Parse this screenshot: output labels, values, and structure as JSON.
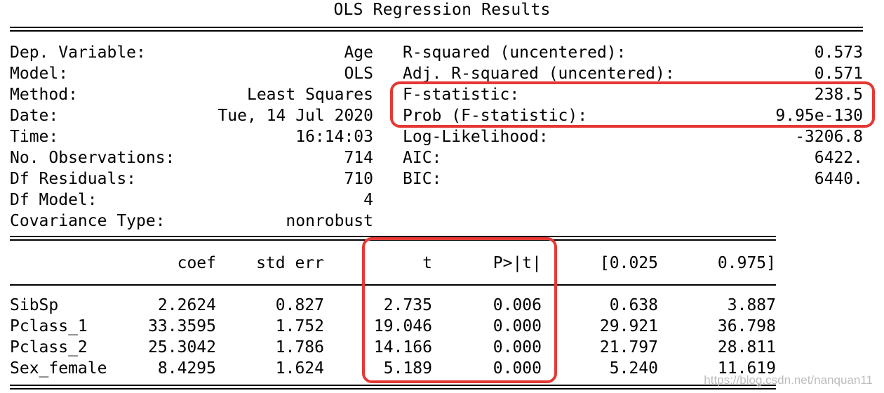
{
  "title": "OLS Regression Results",
  "summary": {
    "left": [
      {
        "label": "Dep. Variable:",
        "value": "Age"
      },
      {
        "label": "Model:",
        "value": "OLS"
      },
      {
        "label": "Method:",
        "value": "Least Squares"
      },
      {
        "label": "Date:",
        "value": "Tue, 14 Jul 2020"
      },
      {
        "label": "Time:",
        "value": "16:14:03"
      },
      {
        "label": "No. Observations:",
        "value": "714"
      },
      {
        "label": "Df Residuals:",
        "value": "710"
      },
      {
        "label": "Df Model:",
        "value": "4"
      },
      {
        "label": "Covariance Type:",
        "value": "nonrobust"
      }
    ],
    "right": [
      {
        "label": "R-squared (uncentered):",
        "value": "0.573"
      },
      {
        "label": "Adj. R-squared (uncentered):",
        "value": "0.571"
      },
      {
        "label": "F-statistic:",
        "value": "238.5"
      },
      {
        "label": "Prob (F-statistic):",
        "value": "9.95e-130"
      },
      {
        "label": "Log-Likelihood:",
        "value": "-3206.8"
      },
      {
        "label": "AIC:",
        "value": "6422."
      },
      {
        "label": "BIC:",
        "value": "6440."
      }
    ]
  },
  "coef_table": {
    "headers": [
      "coef",
      "std err",
      "t",
      "P>|t|",
      "[0.025",
      "0.975]"
    ],
    "rows": [
      {
        "name": "SibSp",
        "values": [
          "2.2624",
          "0.827",
          "2.735",
          "0.006",
          "0.638",
          "3.887"
        ]
      },
      {
        "name": "Pclass_1",
        "values": [
          "33.3595",
          "1.752",
          "19.046",
          "0.000",
          "29.921",
          "36.798"
        ]
      },
      {
        "name": "Pclass_2",
        "values": [
          "25.3042",
          "1.786",
          "14.166",
          "0.000",
          "21.797",
          "28.811"
        ]
      },
      {
        "name": "Sex_female",
        "values": [
          "8.4295",
          "1.624",
          "5.189",
          "0.000",
          "5.240",
          "11.619"
        ]
      }
    ]
  },
  "highlight_color": "#e53935",
  "watermark": "https://blog.csdn.net/nanquan11"
}
